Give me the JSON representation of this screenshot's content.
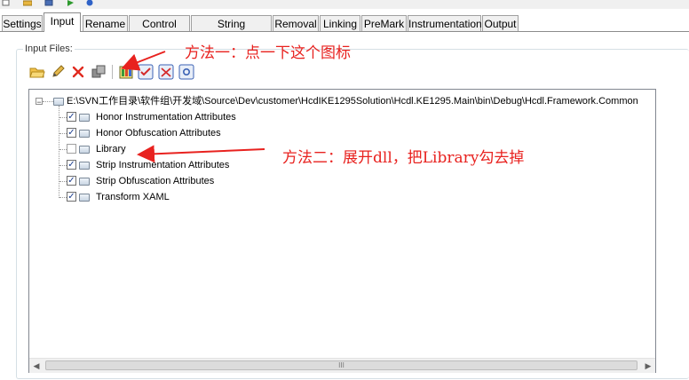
{
  "tabs": [
    {
      "label": "Settings",
      "active": false
    },
    {
      "label": "Input",
      "active": true
    },
    {
      "label": "Rename",
      "active": false
    },
    {
      "label": "Control Flow",
      "active": false
    },
    {
      "label": "String Encryption",
      "active": false
    },
    {
      "label": "Removal",
      "active": false
    },
    {
      "label": "Linking",
      "active": false
    },
    {
      "label": "PreMark",
      "active": false
    },
    {
      "label": "Instrumentation",
      "active": false
    },
    {
      "label": "Output",
      "active": false
    }
  ],
  "input_files": {
    "group_label": "Input Files:",
    "toolbar_icons": [
      "open-folder-icon",
      "edit-pencil-icon",
      "delete-x-icon",
      "properties-icon",
      "assembly-options-icon",
      "check-icon",
      "uncheck-icon",
      "view-icon"
    ],
    "tree": {
      "root": {
        "label": "E:\\SVN工作目录\\软件组\\开发域\\Source\\Dev\\customer\\HcdIKE1295Solution\\Hcdl.KE1295.Main\\bin\\Debug\\Hcdl.Framework.Common",
        "expanded": true
      },
      "children": [
        {
          "label": "Honor Instrumentation Attributes",
          "checked": true
        },
        {
          "label": "Honor Obfuscation Attributes",
          "checked": true
        },
        {
          "label": "Library",
          "checked": false
        },
        {
          "label": "Strip Instrumentation Attributes",
          "checked": true
        },
        {
          "label": "Strip Obfuscation Attributes",
          "checked": true
        },
        {
          "label": "Transform XAML",
          "checked": true
        }
      ]
    },
    "scrollbar_grip": "III"
  },
  "annotations": {
    "method_one": "方法一：点一下这个图标",
    "method_two": "方法二：展开dll，把Library勾去掉"
  },
  "colors": {
    "annotation": "#e8221f",
    "tab_border": "#8c8c8c",
    "check": "#1a3d8f"
  }
}
